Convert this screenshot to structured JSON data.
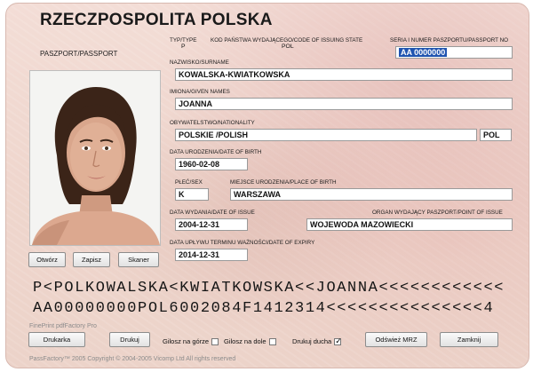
{
  "app": {
    "country_title": "RZECZPOSPOLITA POLSKA",
    "doc_label": "PASZPORT/PASSPORT"
  },
  "fields": {
    "type": {
      "label": "TYP/TYPE",
      "value": "P"
    },
    "code": {
      "label": "KOD PAŃSTWA WYDAJĄCEGO/CODE OF ISSUING STATE",
      "value": "POL"
    },
    "serial": {
      "label": "SERIA I NUMER PASZPORTU/PASSPORT NO",
      "value": "AA 0000000"
    },
    "surname": {
      "label": "NAZWISKO/SURNAME",
      "value": "KOWALSKA-KWIATKOWSKA"
    },
    "given_names": {
      "label": "IMIONA/GIVEN NAMES",
      "value": "JOANNA"
    },
    "nationality": {
      "label": "OBYWATELSTWO/NATIONALITY",
      "value": "POLSKIE /POLISH",
      "code": "POL"
    },
    "birth_date": {
      "label": "DATA URODZENIA/DATE OF BIRTH",
      "value": "1960-02-08"
    },
    "sex": {
      "label": "PŁEĆ/SEX",
      "value": "K"
    },
    "birth_place": {
      "label": "MIEJSCE URODZENIA/PLACE OF BIRTH",
      "value": "WARSZAWA"
    },
    "issue_date": {
      "label": "DATA WYDANIA/DATE OF ISSUE",
      "value": "2004-12-31"
    },
    "authority": {
      "label": "ORGAN WYDAJĄCY PASZPORT/POINT OF ISSUE",
      "value": "WOJEWODA MAZOWIECKI"
    },
    "expiry_date": {
      "label": "DATA UPŁYWU TERMINU WAŻNOŚCI/DATE OF EXPIRY",
      "value": "2014-12-31"
    }
  },
  "photo_buttons": {
    "open": "Otwórz",
    "save": "Zapisz",
    "scan": "Skaner"
  },
  "mrz": {
    "line1": "P<POLKOWALSKA<KWIATKOWSKA<<JOANNA<<<<<<<<<<<<",
    "line2": "AA00000000POL6002084F1412314<<<<<<<<<<<<<<<4"
  },
  "footer": {
    "brand_top": "FinePrint pdfFactory Pro",
    "brand_bottom": "PassFactory™ 2005   Copyright © 2004-2005 Vicomp Ltd   All rights reserved",
    "printer_button": "Drukarka",
    "print_button": "Drukuj",
    "checkboxes": [
      {
        "label": "Gilosz na górze",
        "checked": false
      },
      {
        "label": "Gilosz na dole",
        "checked": false
      },
      {
        "label": "Drukuj ducha",
        "checked": true
      }
    ],
    "change_mrz_button": "Odśwież MRZ",
    "close_button": "Zamknij"
  }
}
